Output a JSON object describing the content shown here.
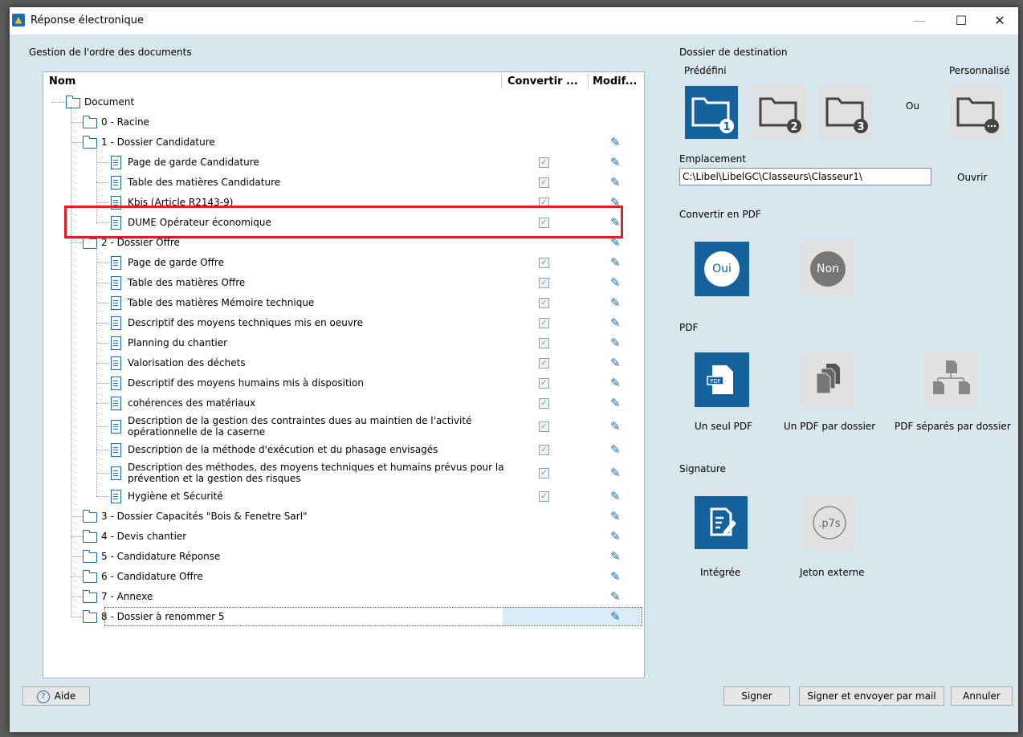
{
  "window": {
    "title": "Réponse électronique"
  },
  "left": {
    "section_label": "Gestion de l'ordre des documents",
    "columns": [
      "Nom",
      "Convertir ...",
      "Modif..."
    ],
    "rows": [
      {
        "label": "Document",
        "type": "folder",
        "level": 0
      },
      {
        "label": "0 - Racine",
        "type": "folder",
        "level": 1
      },
      {
        "label": "1 - Dossier Candidature",
        "type": "folder",
        "level": 1,
        "pencil": true
      },
      {
        "label": "Page de garde Candidature",
        "type": "doc",
        "level": 2,
        "check": true,
        "pencil": true
      },
      {
        "label": "Table des matières Candidature",
        "type": "doc",
        "level": 2,
        "check": true,
        "pencil": true
      },
      {
        "label": "Kbis (Article R2143-9)",
        "type": "doc",
        "level": 2,
        "check": true,
        "pencil": true
      },
      {
        "label": "DUME Opérateur économique",
        "type": "doc",
        "level": 2,
        "check": true,
        "pencil": true
      },
      {
        "label": "2 - Dossier Offre",
        "type": "folder",
        "level": 1,
        "pencil": true
      },
      {
        "label": "Page de garde Offre",
        "type": "doc",
        "level": 2,
        "check": true,
        "pencil": true
      },
      {
        "label": "Table des matières Offre",
        "type": "doc",
        "level": 2,
        "check": true,
        "pencil": true
      },
      {
        "label": "Table des matières Mémoire technique",
        "type": "doc",
        "level": 2,
        "check": true,
        "pencil": true
      },
      {
        "label": "Descriptif des moyens techniques mis en oeuvre",
        "type": "doc",
        "level": 2,
        "check": true,
        "pencil": true
      },
      {
        "label": "Planning du chantier",
        "type": "doc",
        "level": 2,
        "check": true,
        "pencil": true
      },
      {
        "label": "Valorisation des déchets",
        "type": "doc",
        "level": 2,
        "check": true,
        "pencil": true
      },
      {
        "label": "Descriptif des moyens humains mis à disposition",
        "type": "doc",
        "level": 2,
        "check": true,
        "pencil": true
      },
      {
        "label": "cohérences des matériaux",
        "type": "doc",
        "level": 2,
        "check": true,
        "pencil": true
      },
      {
        "label": "Description de la gestion des contraintes dues au maintien de l'activité",
        "label2": "opérationnelle de la caserne",
        "type": "doc",
        "level": 2,
        "check": true,
        "pencil": true
      },
      {
        "label": "Description de la méthode d'exécution et du phasage envisagés",
        "type": "doc",
        "level": 2,
        "check": true,
        "pencil": true
      },
      {
        "label": "Description des méthodes, des moyens techniques et humains prévus pour la",
        "label2": "prévention et la gestion des risques",
        "type": "doc",
        "level": 2,
        "check": true,
        "pencil": true
      },
      {
        "label": "Hygiène et Sécurité",
        "type": "doc",
        "level": 2,
        "check": true,
        "pencil": true
      },
      {
        "label": "3 - Dossier Capacités \"Bois & Fenetre Sarl\"",
        "type": "folder",
        "level": 1,
        "pencil": true
      },
      {
        "label": "4 - Devis chantier",
        "type": "folder",
        "level": 1,
        "pencil": true
      },
      {
        "label": "5 - Candidature Réponse",
        "type": "folder",
        "level": 1,
        "pencil": true
      },
      {
        "label": "6 - Candidature Offre",
        "type": "folder",
        "level": 1,
        "pencil": true
      },
      {
        "label": "7 - Annexe",
        "type": "folder",
        "level": 1,
        "pencil": true
      },
      {
        "label": "8 - Dossier à renommer 5",
        "type": "folder",
        "level": 1,
        "pencil": true,
        "selected": true
      }
    ]
  },
  "right": {
    "dest_label": "Dossier de destination",
    "predefini_label": "Prédéfini",
    "personnalise_label": "Personnalisé",
    "ou_label": "Ou",
    "folder_numbers": [
      "1",
      "2",
      "3"
    ],
    "emplacement_label": "Emplacement",
    "emplacement_value": "C:\\Libel\\LibelGC\\Classeurs\\Classeur1\\",
    "ouvrir_label": "Ouvrir",
    "convertir_label": "Convertir en PDF",
    "oui_label": "Oui",
    "non_label": "Non",
    "pdf_label": "PDF",
    "pdf_options": [
      "Un seul PDF",
      "Un PDF par dossier",
      "PDF séparés par dossier"
    ],
    "pdf_icon_text": "PDF",
    "signature_label": "Signature",
    "signature_options": [
      "Intégrée",
      "Jeton externe"
    ],
    "p7s_text": ".p7s"
  },
  "footer": {
    "aide_label": "Aide",
    "signer_label": "Signer",
    "signer_mail_label": "Signer et envoyer par mail",
    "annuler_label": "Annuler"
  },
  "colors": {
    "accent": "#14629c",
    "selection_box": "#e02020",
    "panel_bg": "#d8e6ee"
  }
}
